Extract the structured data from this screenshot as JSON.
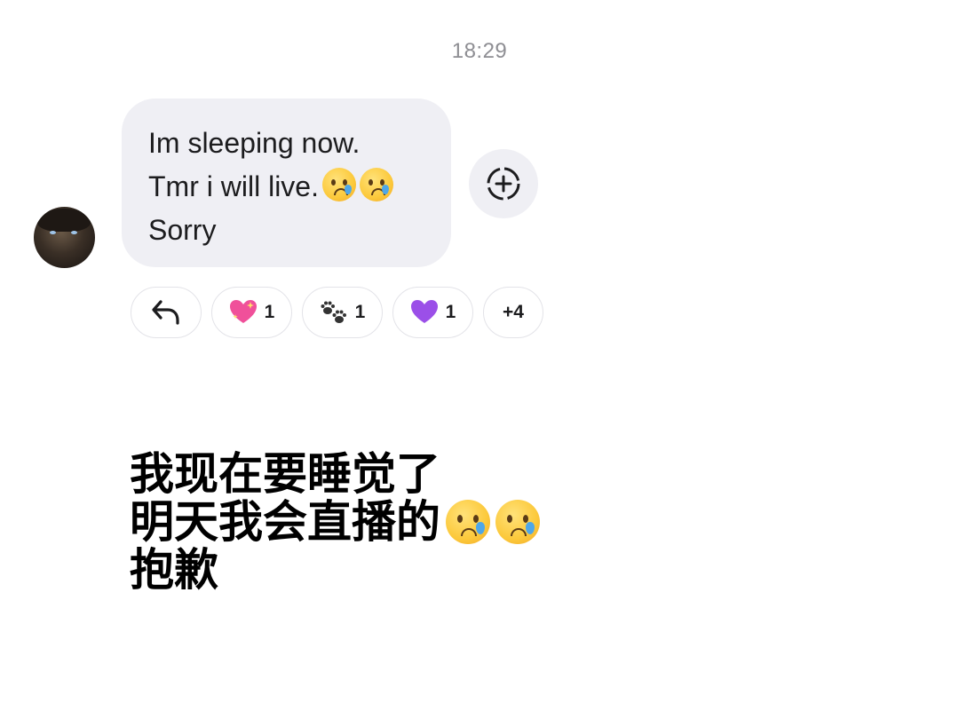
{
  "timestamp": "18:29",
  "message": {
    "lines": [
      "Im sleeping now.",
      "Tmr i will live.",
      "Sorry"
    ],
    "line2_emojis": [
      "crying-face",
      "crying-face"
    ]
  },
  "reactions": {
    "reply_icon": "reply-arrow-icon",
    "items": [
      {
        "emoji": "sparkling-heart",
        "color": "#f0509a",
        "count": "1"
      },
      {
        "emoji": "paw-prints",
        "color": "#333333",
        "count": "1"
      },
      {
        "emoji": "purple-heart",
        "color": "#9b4fe8",
        "count": "1"
      }
    ],
    "more": "+4"
  },
  "add_reaction_icon": "add-reaction-icon",
  "caption": {
    "lines": [
      "我现在要睡觉了",
      "明天我会直播的",
      "抱歉"
    ],
    "line2_emojis": [
      "crying-face",
      "crying-face"
    ]
  }
}
